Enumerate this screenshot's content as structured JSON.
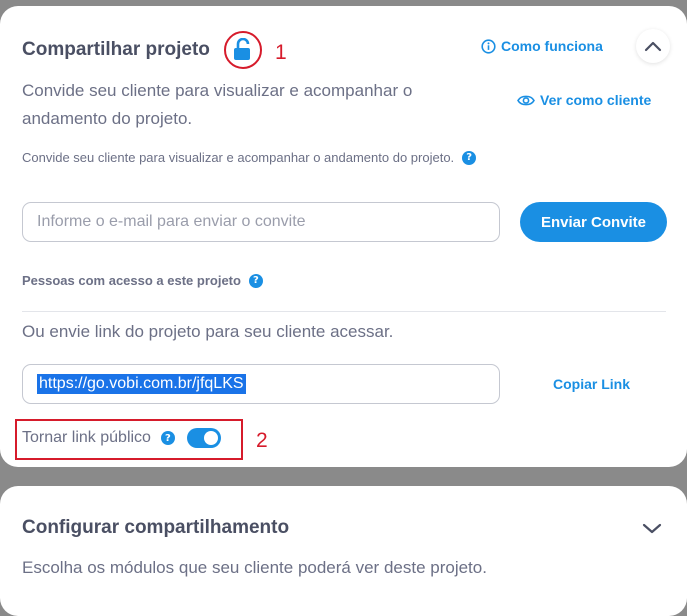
{
  "share": {
    "title": "Compartilhar projeto",
    "annotation_1": "1",
    "how_it_works": "Como funciona",
    "view_as_client": "Ver como cliente",
    "description": "Convide seu cliente para visualizar e acompanhar o andamento do projeto.",
    "description_small": "Convide seu cliente para visualizar e acompanhar o andamento do projeto.",
    "email_placeholder": "Informe o e-mail para enviar o convite",
    "send_button": "Enviar Convite",
    "people_label": "Pessoas com acesso a este projeto",
    "or_send_link": "Ou envie link do projeto para seu cliente acessar.",
    "link_value": "https://go.vobi.com.br/jfqLKS",
    "copy_link": "Copiar Link",
    "public_link_label": "Tornar link público",
    "public_link_enabled": true,
    "annotation_2": "2",
    "help_glyph": "?"
  },
  "config": {
    "title": "Configurar compartilhamento",
    "description": "Escolha os módulos que seu cliente poderá ver deste projeto."
  },
  "colors": {
    "accent": "#1a8fe3",
    "annotation": "#d61b2b"
  }
}
